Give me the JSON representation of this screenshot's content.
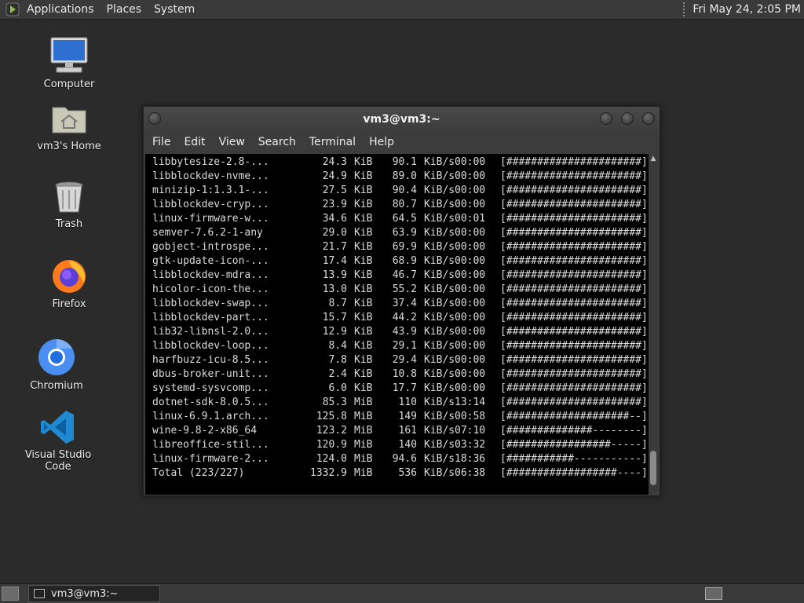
{
  "top_panel": {
    "menus": [
      "Applications",
      "Places",
      "System"
    ],
    "clock": "Fri May 24,  2:05 PM"
  },
  "desktop_icons": [
    {
      "label": "Computer",
      "icon": "computer-icon"
    },
    {
      "label": "vm3's Home",
      "icon": "home-folder-icon"
    },
    {
      "label": "Trash",
      "icon": "trash-icon"
    },
    {
      "label": "Firefox",
      "icon": "firefox-icon"
    },
    {
      "label": "Chromium",
      "icon": "chromium-icon"
    },
    {
      "label": "Visual Studio Code",
      "icon": "vscode-icon"
    }
  ],
  "terminal": {
    "title": "vm3@vm3:~",
    "menu": [
      "File",
      "Edit",
      "View",
      "Search",
      "Terminal",
      "Help"
    ],
    "rows": [
      {
        "name": "libbytesize-2.8-...",
        "size": "24.3",
        "unit": "KiB",
        "rate": "90.1",
        "rate_unit": "KiB/s",
        "time": "00:00",
        "bar": "[######################]",
        "pct": "100%"
      },
      {
        "name": "libblockdev-nvme...",
        "size": "24.9",
        "unit": "KiB",
        "rate": "89.0",
        "rate_unit": "KiB/s",
        "time": "00:00",
        "bar": "[######################]",
        "pct": "100%"
      },
      {
        "name": "minizip-1:1.3.1-...",
        "size": "27.5",
        "unit": "KiB",
        "rate": "90.4",
        "rate_unit": "KiB/s",
        "time": "00:00",
        "bar": "[######################]",
        "pct": "100%"
      },
      {
        "name": "libblockdev-cryp...",
        "size": "23.9",
        "unit": "KiB",
        "rate": "80.7",
        "rate_unit": "KiB/s",
        "time": "00:00",
        "bar": "[######################]",
        "pct": "100%"
      },
      {
        "name": "linux-firmware-w...",
        "size": "34.6",
        "unit": "KiB",
        "rate": "64.5",
        "rate_unit": "KiB/s",
        "time": "00:01",
        "bar": "[######################]",
        "pct": "100%"
      },
      {
        "name": "semver-7.6.2-1-any",
        "size": "29.0",
        "unit": "KiB",
        "rate": "63.9",
        "rate_unit": "KiB/s",
        "time": "00:00",
        "bar": "[######################]",
        "pct": "100%"
      },
      {
        "name": "gobject-introspe...",
        "size": "21.7",
        "unit": "KiB",
        "rate": "69.9",
        "rate_unit": "KiB/s",
        "time": "00:00",
        "bar": "[######################]",
        "pct": "100%"
      },
      {
        "name": "gtk-update-icon-...",
        "size": "17.4",
        "unit": "KiB",
        "rate": "68.9",
        "rate_unit": "KiB/s",
        "time": "00:00",
        "bar": "[######################]",
        "pct": "100%"
      },
      {
        "name": "libblockdev-mdra...",
        "size": "13.9",
        "unit": "KiB",
        "rate": "46.7",
        "rate_unit": "KiB/s",
        "time": "00:00",
        "bar": "[######################]",
        "pct": "100%"
      },
      {
        "name": "hicolor-icon-the...",
        "size": "13.0",
        "unit": "KiB",
        "rate": "55.2",
        "rate_unit": "KiB/s",
        "time": "00:00",
        "bar": "[######################]",
        "pct": "100%"
      },
      {
        "name": "libblockdev-swap...",
        "size": "8.7",
        "unit": "KiB",
        "rate": "37.4",
        "rate_unit": "KiB/s",
        "time": "00:00",
        "bar": "[######################]",
        "pct": "100%"
      },
      {
        "name": "libblockdev-part...",
        "size": "15.7",
        "unit": "KiB",
        "rate": "44.2",
        "rate_unit": "KiB/s",
        "time": "00:00",
        "bar": "[######################]",
        "pct": "100%"
      },
      {
        "name": "lib32-libnsl-2.0...",
        "size": "12.9",
        "unit": "KiB",
        "rate": "43.9",
        "rate_unit": "KiB/s",
        "time": "00:00",
        "bar": "[######################]",
        "pct": "100%"
      },
      {
        "name": "libblockdev-loop...",
        "size": "8.4",
        "unit": "KiB",
        "rate": "29.1",
        "rate_unit": "KiB/s",
        "time": "00:00",
        "bar": "[######################]",
        "pct": "100%"
      },
      {
        "name": "harfbuzz-icu-8.5...",
        "size": "7.8",
        "unit": "KiB",
        "rate": "29.4",
        "rate_unit": "KiB/s",
        "time": "00:00",
        "bar": "[######################]",
        "pct": "100%"
      },
      {
        "name": "dbus-broker-unit...",
        "size": "2.4",
        "unit": "KiB",
        "rate": "10.8",
        "rate_unit": "KiB/s",
        "time": "00:00",
        "bar": "[######################]",
        "pct": "100%"
      },
      {
        "name": "systemd-sysvcomp...",
        "size": "6.0",
        "unit": "KiB",
        "rate": "17.7",
        "rate_unit": "KiB/s",
        "time": "00:00",
        "bar": "[######################]",
        "pct": "100%"
      },
      {
        "name": "dotnet-sdk-8.0.5...",
        "size": "85.3",
        "unit": "MiB",
        "rate": "110",
        "rate_unit": "KiB/s",
        "time": "13:14",
        "bar": "[######################]",
        "pct": "100%"
      },
      {
        "name": "linux-6.9.1.arch...",
        "size": "125.8",
        "unit": "MiB",
        "rate": "149",
        "rate_unit": "KiB/s",
        "time": "00:58",
        "bar": "[####################--]",
        "pct": "93%"
      },
      {
        "name": "wine-9.8-2-x86_64",
        "size": "123.2",
        "unit": "MiB",
        "rate": "161",
        "rate_unit": "KiB/s",
        "time": "07:10",
        "bar": "[##############--------]",
        "pct": "64%"
      },
      {
        "name": "libreoffice-stil...",
        "size": "120.9",
        "unit": "MiB",
        "rate": "140",
        "rate_unit": "KiB/s",
        "time": "03:32",
        "bar": "[#################-----]",
        "pct": "80%"
      },
      {
        "name": "linux-firmware-2...",
        "size": "124.0",
        "unit": "MiB",
        "rate": "94.6",
        "rate_unit": "KiB/s",
        "time": "18:36",
        "bar": "[###########-----------]",
        "pct": "54%"
      },
      {
        "name": "Total (223/227)",
        "size": "1332.9",
        "unit": "MiB",
        "rate": "536",
        "rate_unit": "KiB/s",
        "time": "06:38",
        "bar": "[##################----]",
        "pct": "86%"
      }
    ]
  },
  "taskbar": {
    "task_label": "vm3@vm3:~"
  },
  "colors": {
    "desktop_bg": "#2b2b2b",
    "panel_bg": "#3a3a3a",
    "terminal_bg": "#000000",
    "terminal_fg": "#dcdcdc"
  }
}
